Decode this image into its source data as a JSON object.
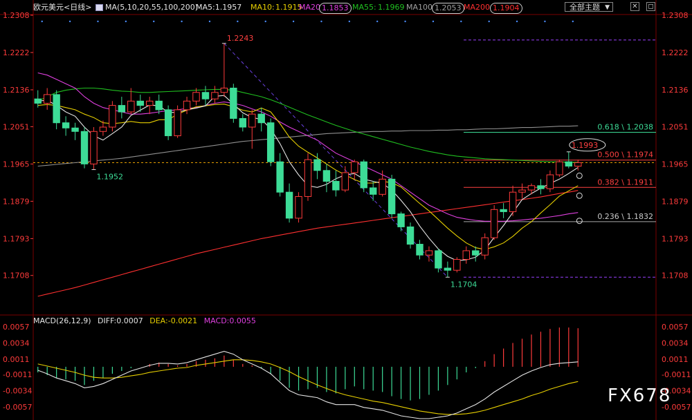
{
  "header": {
    "symbol": "欧元美元<日线>",
    "ma_params": "MA(5,10,20,55,100,200)",
    "ma5": "MA5:1.1957",
    "ma10_label": "MA10:",
    "ma10_value": "1.1915",
    "ma20_label": "MA20",
    "ma20_value": "1.1853",
    "ma55_label": "MA55:",
    "ma55_value": "1.1969",
    "ma100_label": "MA100",
    "ma100_value": "1.2053",
    "ma200_label": "MA200",
    "ma200_value": "1.1904",
    "theme_button": "全部主题",
    "theme_arrow": "▼"
  },
  "macd_header": {
    "title": "MACD(26,12,9)",
    "diff": "DIFF:0.0007",
    "dea": "DEA:-0.0021",
    "macd": "MACD:0.0055"
  },
  "watermark": "FX678",
  "colors": {
    "up": "#ff3b3b",
    "down": "#3ddc97",
    "ma5": "#e6e6e6",
    "ma10": "#e8d000",
    "ma20": "#e040e0",
    "ma55": "#20c020",
    "ma100": "#909090",
    "ma200": "#ff3030"
  },
  "chart_data": [
    {
      "type": "candlestick",
      "ylim": [
        1.162,
        1.2308
      ],
      "y_ticks": [
        "1.2308",
        "1.2222",
        "1.2136",
        "1.2051",
        "1.1965",
        "1.1879",
        "1.1793",
        "1.1708"
      ],
      "candles": [
        {
          "o": 1.2115,
          "h": 1.2135,
          "l": 1.2095,
          "c": 1.2105
        },
        {
          "o": 1.2105,
          "h": 1.214,
          "l": 1.209,
          "c": 1.2125
        },
        {
          "o": 1.2125,
          "h": 1.2135,
          "l": 1.2045,
          "c": 1.206
        },
        {
          "o": 1.206,
          "h": 1.2075,
          "l": 1.203,
          "c": 1.2048
        },
        {
          "o": 1.2048,
          "h": 1.206,
          "l": 1.202,
          "c": 1.204
        },
        {
          "o": 1.204,
          "h": 1.205,
          "l": 1.1955,
          "c": 1.1965
        },
        {
          "o": 1.1965,
          "h": 1.205,
          "l": 1.1952,
          "c": 1.204
        },
        {
          "o": 1.204,
          "h": 1.2065,
          "l": 1.203,
          "c": 1.205
        },
        {
          "o": 1.205,
          "h": 1.211,
          "l": 1.204,
          "c": 1.21
        },
        {
          "o": 1.21,
          "h": 1.212,
          "l": 1.207,
          "c": 1.2085
        },
        {
          "o": 1.2085,
          "h": 1.214,
          "l": 1.208,
          "c": 1.211
        },
        {
          "o": 1.211,
          "h": 1.2125,
          "l": 1.2085,
          "c": 1.21
        },
        {
          "o": 1.21,
          "h": 1.212,
          "l": 1.208,
          "c": 1.211
        },
        {
          "o": 1.211,
          "h": 1.2125,
          "l": 1.208,
          "c": 1.209
        },
        {
          "o": 1.209,
          "h": 1.21,
          "l": 1.202,
          "c": 1.203
        },
        {
          "o": 1.203,
          "h": 1.21,
          "l": 1.2025,
          "c": 1.209
        },
        {
          "o": 1.209,
          "h": 1.212,
          "l": 1.208,
          "c": 1.211
        },
        {
          "o": 1.211,
          "h": 1.214,
          "l": 1.21,
          "c": 1.213
        },
        {
          "o": 1.213,
          "h": 1.2145,
          "l": 1.21,
          "c": 1.2115
        },
        {
          "o": 1.2115,
          "h": 1.2145,
          "l": 1.2105,
          "c": 1.213
        },
        {
          "o": 1.213,
          "h": 1.2243,
          "l": 1.212,
          "c": 1.214
        },
        {
          "o": 1.214,
          "h": 1.215,
          "l": 1.206,
          "c": 1.207
        },
        {
          "o": 1.207,
          "h": 1.208,
          "l": 1.204,
          "c": 1.205
        },
        {
          "o": 1.205,
          "h": 1.209,
          "l": 1.2,
          "c": 1.208
        },
        {
          "o": 1.208,
          "h": 1.2095,
          "l": 1.204,
          "c": 1.206
        },
        {
          "o": 1.206,
          "h": 1.207,
          "l": 1.196,
          "c": 1.197
        },
        {
          "o": 1.197,
          "h": 1.199,
          "l": 1.189,
          "c": 1.19
        },
        {
          "o": 1.19,
          "h": 1.192,
          "l": 1.183,
          "c": 1.184
        },
        {
          "o": 1.184,
          "h": 1.19,
          "l": 1.183,
          "c": 1.189
        },
        {
          "o": 1.189,
          "h": 1.199,
          "l": 1.188,
          "c": 1.1975
        },
        {
          "o": 1.1975,
          "h": 1.199,
          "l": 1.193,
          "c": 1.195
        },
        {
          "o": 1.195,
          "h": 1.1965,
          "l": 1.19,
          "c": 1.1925
        },
        {
          "o": 1.1925,
          "h": 1.195,
          "l": 1.189,
          "c": 1.1905
        },
        {
          "o": 1.1905,
          "h": 1.196,
          "l": 1.19,
          "c": 1.1945
        },
        {
          "o": 1.1945,
          "h": 1.1975,
          "l": 1.193,
          "c": 1.197
        },
        {
          "o": 1.197,
          "h": 1.1975,
          "l": 1.19,
          "c": 1.191
        },
        {
          "o": 1.191,
          "h": 1.1925,
          "l": 1.188,
          "c": 1.1895
        },
        {
          "o": 1.1895,
          "h": 1.195,
          "l": 1.189,
          "c": 1.193
        },
        {
          "o": 1.193,
          "h": 1.194,
          "l": 1.184,
          "c": 1.185
        },
        {
          "o": 1.185,
          "h": 1.1855,
          "l": 1.181,
          "c": 1.182
        },
        {
          "o": 1.182,
          "h": 1.183,
          "l": 1.177,
          "c": 1.178
        },
        {
          "o": 1.178,
          "h": 1.179,
          "l": 1.1745,
          "c": 1.1755
        },
        {
          "o": 1.1755,
          "h": 1.1775,
          "l": 1.174,
          "c": 1.1765
        },
        {
          "o": 1.1765,
          "h": 1.177,
          "l": 1.1715,
          "c": 1.1725
        },
        {
          "o": 1.1725,
          "h": 1.174,
          "l": 1.1704,
          "c": 1.172
        },
        {
          "o": 1.172,
          "h": 1.175,
          "l": 1.1715,
          "c": 1.1745
        },
        {
          "o": 1.1745,
          "h": 1.1775,
          "l": 1.1735,
          "c": 1.1765
        },
        {
          "o": 1.1765,
          "h": 1.1775,
          "l": 1.174,
          "c": 1.1755
        },
        {
          "o": 1.1755,
          "h": 1.1805,
          "l": 1.1745,
          "c": 1.1795
        },
        {
          "o": 1.1795,
          "h": 1.187,
          "l": 1.179,
          "c": 1.186
        },
        {
          "o": 1.186,
          "h": 1.1875,
          "l": 1.184,
          "c": 1.1855
        },
        {
          "o": 1.1855,
          "h": 1.1915,
          "l": 1.1845,
          "c": 1.19
        },
        {
          "o": 1.19,
          "h": 1.192,
          "l": 1.1885,
          "c": 1.1905
        },
        {
          "o": 1.1905,
          "h": 1.192,
          "l": 1.1895,
          "c": 1.1915
        },
        {
          "o": 1.1915,
          "h": 1.193,
          "l": 1.1895,
          "c": 1.1908
        },
        {
          "o": 1.1908,
          "h": 1.195,
          "l": 1.19,
          "c": 1.194
        },
        {
          "o": 1.194,
          "h": 1.1975,
          "l": 1.1935,
          "c": 1.197
        },
        {
          "o": 1.197,
          "h": 1.1993,
          "l": 1.1955,
          "c": 1.196
        },
        {
          "o": 1.196,
          "h": 1.1975,
          "l": 1.195,
          "c": 1.1968
        }
      ],
      "ma5": [
        1.211,
        1.2112,
        1.21,
        1.2085,
        1.2075,
        1.205,
        1.203,
        1.202,
        1.2035,
        1.205,
        1.2077,
        1.2089,
        1.2101,
        1.2099,
        1.2084,
        1.2084,
        1.209,
        1.2094,
        1.2099,
        1.2121,
        1.2123,
        1.2103,
        1.2083,
        1.2072,
        1.2068,
        1.2046,
        1.2012,
        1.197,
        1.194,
        1.1915,
        1.1911,
        1.1918,
        1.1931,
        1.194,
        1.1943,
        1.193,
        1.1925,
        1.192,
        1.1905,
        1.1881,
        1.1855,
        1.1822,
        1.1794,
        1.1769,
        1.1752,
        1.1742,
        1.1744,
        1.175,
        1.1767,
        1.1796,
        1.1823,
        1.1853,
        1.1883,
        1.1897,
        1.1909,
        1.192,
        1.193,
        1.1943,
        1.1957
      ],
      "ma10": [
        1.21,
        1.2102,
        1.21,
        1.2095,
        1.209,
        1.208,
        1.2072,
        1.206,
        1.2058,
        1.206,
        1.2063,
        1.206,
        1.206,
        1.2067,
        1.2067,
        1.208,
        1.2089,
        1.2097,
        1.2099,
        1.2102,
        1.2103,
        1.2097,
        1.2089,
        1.2085,
        1.2094,
        1.2085,
        1.2058,
        1.2027,
        1.2006,
        1.1992,
        1.1979,
        1.1965,
        1.1951,
        1.194,
        1.1929,
        1.1921,
        1.1921,
        1.1925,
        1.1922,
        1.1912,
        1.1893,
        1.1874,
        1.1857,
        1.1837,
        1.1817,
        1.1799,
        1.1783,
        1.1772,
        1.1768,
        1.1774,
        1.1783,
        1.1798,
        1.1817,
        1.1832,
        1.1852,
        1.1871,
        1.1891,
        1.1903,
        1.1915
      ],
      "ma20": [
        1.2175,
        1.217,
        1.216,
        1.215,
        1.214,
        1.212,
        1.2105,
        1.2095,
        1.209,
        1.2085,
        1.208,
        1.208,
        1.2082,
        1.2085,
        1.2088,
        1.209,
        1.2093,
        1.2095,
        1.21,
        1.2105,
        1.2108,
        1.2105,
        1.21,
        1.2092,
        1.2085,
        1.2075,
        1.2062,
        1.205,
        1.204,
        1.203,
        1.202,
        1.2005,
        1.199,
        1.198,
        1.197,
        1.196,
        1.195,
        1.194,
        1.193,
        1.1915,
        1.19,
        1.1885,
        1.187,
        1.186,
        1.185,
        1.1842,
        1.1838,
        1.1835,
        1.1833,
        1.1833,
        1.1833,
        1.1834,
        1.1836,
        1.1838,
        1.184,
        1.1843,
        1.1846,
        1.185,
        1.1853
      ],
      "ma55": [
        1.211,
        1.212,
        1.213,
        1.2135,
        1.2138,
        1.214,
        1.214,
        1.2138,
        1.2135,
        1.2133,
        1.2132,
        1.213,
        1.213,
        1.2131,
        1.2132,
        1.2133,
        1.2134,
        1.2135,
        1.2136,
        1.2137,
        1.2137,
        1.2135,
        1.213,
        1.2125,
        1.212,
        1.2113,
        1.2105,
        1.2096,
        1.2087,
        1.2078,
        1.207,
        1.2062,
        1.2054,
        1.2047,
        1.204,
        1.2034,
        1.2028,
        1.2022,
        1.2016,
        1.201,
        1.2004,
        1.1999,
        1.1994,
        1.199,
        1.1986,
        1.1983,
        1.1981,
        1.1979,
        1.1977,
        1.1976,
        1.1975,
        1.1974,
        1.1973,
        1.1972,
        1.1971,
        1.197,
        1.197,
        1.1969,
        1.1969
      ],
      "ma100": [
        1.196,
        1.1962,
        1.1964,
        1.1966,
        1.1968,
        1.197,
        1.1972,
        1.1974,
        1.1976,
        1.1978,
        1.1981,
        1.1984,
        1.1987,
        1.199,
        1.1993,
        1.1996,
        1.1999,
        1.2002,
        1.2005,
        1.2008,
        1.2011,
        1.2014,
        1.2017,
        1.2019,
        1.2021,
        1.2023,
        1.2025,
        1.2027,
        1.2029,
        1.2031,
        1.2033,
        1.2035,
        1.2036,
        1.2037,
        1.2038,
        1.2039,
        1.204,
        1.204,
        1.2041,
        1.2041,
        1.2042,
        1.2042,
        1.2042,
        1.2043,
        1.2043,
        1.2044,
        1.2044,
        1.2045,
        1.2046,
        1.2046,
        1.2047,
        1.2048,
        1.2049,
        1.2049,
        1.205,
        1.2051,
        1.2052,
        1.2052,
        1.2053
      ],
      "ma200": [
        1.166,
        1.1665,
        1.167,
        1.1675,
        1.168,
        1.1686,
        1.1692,
        1.1698,
        1.1704,
        1.171,
        1.1716,
        1.1722,
        1.1728,
        1.1734,
        1.174,
        1.1746,
        1.1752,
        1.1758,
        1.1763,
        1.1768,
        1.1773,
        1.1778,
        1.1783,
        1.1788,
        1.1793,
        1.1797,
        1.1801,
        1.1805,
        1.1809,
        1.1813,
        1.1817,
        1.182,
        1.1823,
        1.1826,
        1.1829,
        1.1832,
        1.1835,
        1.1838,
        1.1841,
        1.1844,
        1.1847,
        1.185,
        1.1853,
        1.1856,
        1.1859,
        1.1862,
        1.1865,
        1.1868,
        1.1871,
        1.1874,
        1.1877,
        1.188,
        1.1883,
        1.1886,
        1.1889,
        1.1893,
        1.1897,
        1.19,
        1.1904
      ],
      "annotations": [
        {
          "label": "1.2243",
          "x": 20,
          "y": 1.2243,
          "color": "#ff4040"
        },
        {
          "label": "1.1952",
          "x": 6,
          "y": 1.1952,
          "color": "#3ddc97"
        },
        {
          "label": "1.1704",
          "x": 44,
          "y": 1.1704,
          "color": "#3ddc97"
        },
        {
          "label": "1.1993",
          "x": 57,
          "y": 1.1993,
          "color": "#ff4040",
          "circled": true
        }
      ],
      "fibonacci": [
        {
          "label": "0.618 \\ 1.2038",
          "y": 1.2038,
          "color": "#3ddc97",
          "line": "#3ddc97"
        },
        {
          "label": "0.500 \\ 1.1974",
          "y": 1.1974,
          "color": "#ff4040",
          "line": "#ff4040"
        },
        {
          "label": "0.382 \\ 1.1911",
          "y": 1.1911,
          "color": "#ff4040",
          "line": "#ff4040"
        },
        {
          "label": "0.236 \\ 1.1832",
          "y": 1.1832,
          "color": "#cccccc",
          "line": "#aaaaaa"
        }
      ],
      "fib_top": 1.2243,
      "fib_bottom": 1.1704,
      "current_price": 1.1968
    },
    {
      "type": "macd",
      "ylim": [
        -0.0072,
        0.0064
      ],
      "y_ticks": [
        "0.0057",
        "0.0034",
        "0.0011",
        "-0.0011",
        "-0.0034",
        "-0.0057"
      ],
      "histogram": [
        -0.0008,
        -0.0012,
        -0.0016,
        -0.0018,
        -0.002,
        -0.0026,
        -0.002,
        -0.0016,
        -0.001,
        -0.0006,
        -0.0002,
        0.0,
        0.0004,
        0.0006,
        0.0004,
        0.0002,
        0.0004,
        0.0008,
        0.001,
        0.0012,
        0.0016,
        0.001,
        0.0004,
        0.0002,
        -0.0002,
        -0.001,
        -0.002,
        -0.003,
        -0.0034,
        -0.0032,
        -0.003,
        -0.0036,
        -0.0038,
        -0.0032,
        -0.0028,
        -0.0032,
        -0.0034,
        -0.0036,
        -0.0042,
        -0.0046,
        -0.0048,
        -0.0046,
        -0.004,
        -0.0034,
        -0.0026,
        -0.0018,
        -0.0008,
        -0.0002,
        0.0008,
        0.0018,
        0.0026,
        0.0034,
        0.004,
        0.0046,
        0.005,
        0.0054,
        0.0056,
        0.0056,
        0.0055
      ],
      "diff": [
        -0.0005,
        -0.001,
        -0.0016,
        -0.002,
        -0.0024,
        -0.003,
        -0.0028,
        -0.0024,
        -0.0018,
        -0.0012,
        -0.0006,
        -0.0002,
        0.0002,
        0.0005,
        0.0005,
        0.0004,
        0.0006,
        0.001,
        0.0014,
        0.0018,
        0.0022,
        0.0018,
        0.001,
        0.0004,
        -0.0002,
        -0.001,
        -0.0022,
        -0.0034,
        -0.004,
        -0.0042,
        -0.0044,
        -0.005,
        -0.0054,
        -0.0054,
        -0.0054,
        -0.0058,
        -0.006,
        -0.0062,
        -0.0066,
        -0.007,
        -0.0072,
        -0.0074,
        -0.0074,
        -0.0072,
        -0.007,
        -0.0066,
        -0.006,
        -0.0054,
        -0.0046,
        -0.0036,
        -0.0028,
        -0.002,
        -0.0012,
        -0.0006,
        -0.0001,
        0.0003,
        0.0005,
        0.0006,
        0.0007
      ],
      "dea": [
        0.0004,
        0.0001,
        -0.0002,
        -0.0005,
        -0.0008,
        -0.0012,
        -0.0015,
        -0.0016,
        -0.0016,
        -0.0015,
        -0.0013,
        -0.0011,
        -0.0008,
        -0.0006,
        -0.0004,
        -0.0002,
        -0.0001,
        0.0002,
        0.0004,
        0.0006,
        0.0008,
        0.001,
        0.001,
        0.0009,
        0.0007,
        0.0004,
        -0.0001,
        -0.0007,
        -0.0014,
        -0.002,
        -0.0026,
        -0.0031,
        -0.0036,
        -0.004,
        -0.0043,
        -0.0046,
        -0.0049,
        -0.0051,
        -0.0054,
        -0.0057,
        -0.006,
        -0.0063,
        -0.0065,
        -0.0067,
        -0.0068,
        -0.0068,
        -0.0067,
        -0.0065,
        -0.0062,
        -0.0058,
        -0.0054,
        -0.005,
        -0.0046,
        -0.0041,
        -0.0037,
        -0.0032,
        -0.0028,
        -0.0024,
        -0.0021
      ]
    }
  ]
}
